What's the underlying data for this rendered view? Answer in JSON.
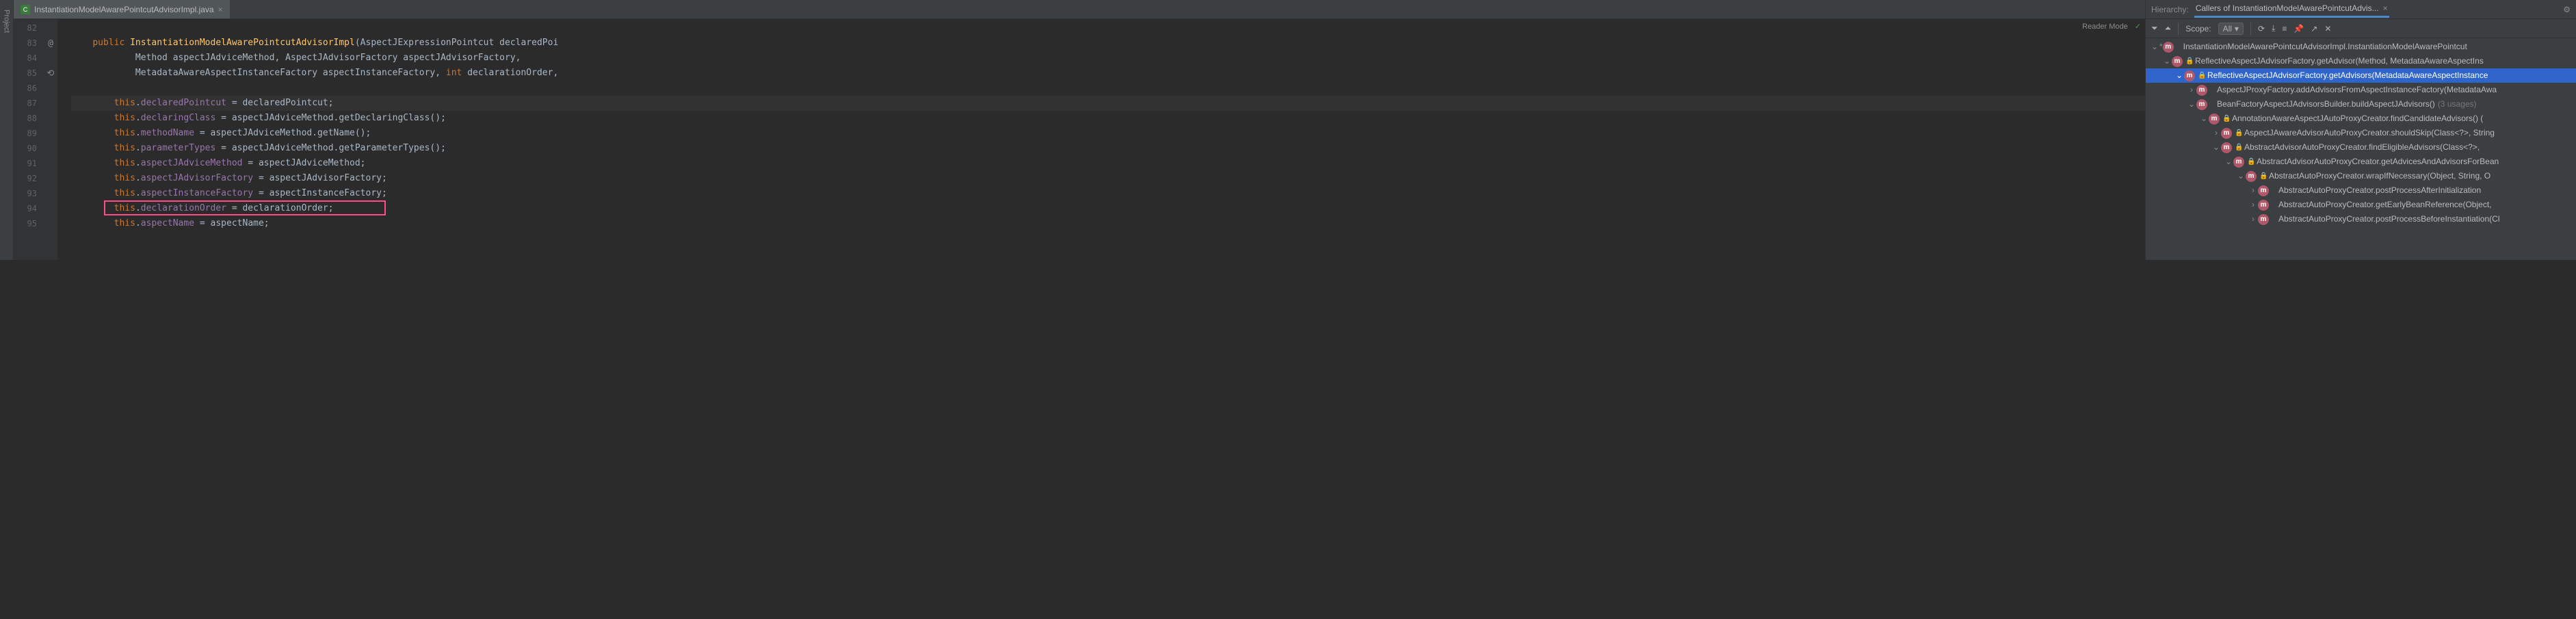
{
  "tab": {
    "filename": "InstantiationModelAwarePointcutAdvisorImpl.java"
  },
  "editor": {
    "reader_mode": "Reader Mode",
    "lines": [
      {
        "num": "82",
        "icon": "",
        "html": ""
      },
      {
        "num": "83",
        "icon": "@",
        "html": "    <span class='kw'>public</span> <span class='method'>InstantiationModelAwarePointcutAdvisorImpl</span>(AspectJExpressionPointcut <span class='param'>declaredPoi</span>"
      },
      {
        "num": "84",
        "icon": "",
        "html": "            Method <span class='param'>aspectJAdviceMethod</span>, AspectJAdvisorFactory <span class='param'>aspectJAdvisorFactory</span>,"
      },
      {
        "num": "85",
        "icon": "⟲",
        "html": "            MetadataAwareAspectInstanceFactory <span class='param'>aspectInstanceFactory</span>, <span class='kw'>int</span> <span class='param'>declarationOrder</span>,"
      },
      {
        "num": "86",
        "icon": "",
        "html": ""
      },
      {
        "num": "87",
        "icon": "",
        "html": "        <span class='kw'>this</span>.<span class='field'>declaredPointcut</span> = declaredPointcut;",
        "caret": true
      },
      {
        "num": "88",
        "icon": "",
        "html": "        <span class='kw'>this</span>.<span class='field'>declaringClass</span> = aspectJAdviceMethod.getDeclaringClass();"
      },
      {
        "num": "89",
        "icon": "",
        "html": "        <span class='kw'>this</span>.<span class='field'>methodName</span> = aspectJAdviceMethod.getName();"
      },
      {
        "num": "90",
        "icon": "",
        "html": "        <span class='kw'>this</span>.<span class='field'>parameterTypes</span> = aspectJAdviceMethod.getParameterTypes();"
      },
      {
        "num": "91",
        "icon": "",
        "html": "        <span class='kw'>this</span>.<span class='field'>aspectJAdviceMethod</span> = aspectJAdviceMethod;"
      },
      {
        "num": "92",
        "icon": "",
        "html": "        <span class='kw'>this</span>.<span class='field'>aspectJAdvisorFactory</span> = aspectJAdvisorFactory;"
      },
      {
        "num": "93",
        "icon": "",
        "html": "        <span class='kw'>this</span>.<span class='field'>aspectInstanceFactory</span> = aspectInstanceFactory;"
      },
      {
        "num": "94",
        "icon": "",
        "html": "        <span class='kw'>this</span>.<span class='field'>declarationOrder</span> = declarationOrder;",
        "boxed": true
      },
      {
        "num": "95",
        "icon": "",
        "html": "        <span class='kw'>this</span>.<span class='field'>aspectName</span> = aspectName;"
      }
    ]
  },
  "hierarchy": {
    "title": "Hierarchy:",
    "tab_label": "Callers of InstantiationModelAwarePointcutAdvis...",
    "scope_label": "Scope:",
    "scope_value": "All",
    "tree": [
      {
        "indent": 0,
        "arrow": "v",
        "star": true,
        "lock": false,
        "text": "InstantiationModelAwarePointcutAdvisorImpl.InstantiationModelAwarePointcut"
      },
      {
        "indent": 1,
        "arrow": "v",
        "lock": true,
        "text": "ReflectiveAspectJAdvisorFactory.getAdvisor(Method, MetadataAwareAspectIns"
      },
      {
        "indent": 2,
        "arrow": "v",
        "lock": true,
        "text": "ReflectiveAspectJAdvisorFactory.getAdvisors(MetadataAwareAspectInstance",
        "selected": true
      },
      {
        "indent": 3,
        "arrow": ">",
        "lock": false,
        "text": "AspectJProxyFactory.addAdvisorsFromAspectInstanceFactory(MetadataAwa"
      },
      {
        "indent": 3,
        "arrow": "v",
        "lock": false,
        "text": "BeanFactoryAspectJAdvisorsBuilder.buildAspectJAdvisors()",
        "usages": "(3 usages)"
      },
      {
        "indent": 4,
        "arrow": "v",
        "lock": true,
        "text": "AnnotationAwareAspectJAutoProxyCreator.findCandidateAdvisors()  ("
      },
      {
        "indent": 5,
        "arrow": ">",
        "lock": true,
        "text": "AspectJAwareAdvisorAutoProxyCreator.shouldSkip(Class<?>, String"
      },
      {
        "indent": 5,
        "arrow": "v",
        "lock": true,
        "text": "AbstractAdvisorAutoProxyCreator.findEligibleAdvisors(Class<?>, "
      },
      {
        "indent": 6,
        "arrow": "v",
        "lock": true,
        "text": "AbstractAdvisorAutoProxyCreator.getAdvicesAndAdvisorsForBean"
      },
      {
        "indent": 7,
        "arrow": "v",
        "lock": true,
        "text": "AbstractAutoProxyCreator.wrapIfNecessary(Object, String, O"
      },
      {
        "indent": 8,
        "arrow": ">",
        "lock": false,
        "text": "AbstractAutoProxyCreator.postProcessAfterInitialization"
      },
      {
        "indent": 8,
        "arrow": ">",
        "lock": false,
        "text": "AbstractAutoProxyCreator.getEarlyBeanReference(Object, "
      },
      {
        "indent": 8,
        "arrow": ">",
        "lock": false,
        "text": "AbstractAutoProxyCreator.postProcessBeforeInstantiation(Cl"
      }
    ]
  }
}
